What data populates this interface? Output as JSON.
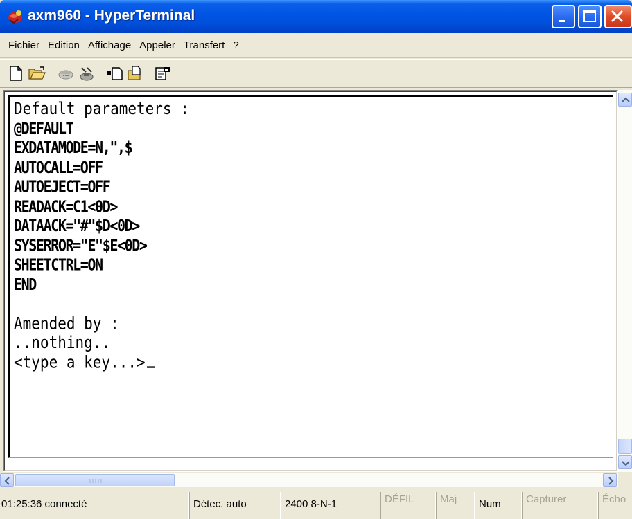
{
  "window": {
    "title": "axm960 - HyperTerminal"
  },
  "menu": [
    "Fichier",
    "Edition",
    "Affichage",
    "Appeler",
    "Transfert",
    "?"
  ],
  "toolbar": {
    "icons": [
      "new-document-icon",
      "open-folder-icon",
      "phone-dial-icon",
      "disconnect-icon",
      "send-icon",
      "receive-icon",
      "properties-icon"
    ]
  },
  "terminal": {
    "lines": [
      {
        "text": "Default parameters :",
        "style": "normal"
      },
      {
        "text": "@DEFAULT",
        "style": "cond"
      },
      {
        "text": "EXDATAMODE=N,\",$",
        "style": "cond"
      },
      {
        "text": "AUTOCALL=OFF",
        "style": "cond"
      },
      {
        "text": "AUTOEJECT=OFF",
        "style": "cond"
      },
      {
        "text": "READACK=C1<0D>",
        "style": "cond"
      },
      {
        "text": "DATAACK=\"#\"$D<0D>",
        "style": "cond"
      },
      {
        "text": "SYSERROR=\"E\"$E<0D>",
        "style": "cond"
      },
      {
        "text": "SHEETCTRL=ON",
        "style": "cond"
      },
      {
        "text": "END",
        "style": "cond"
      },
      {
        "text": "",
        "style": "normal"
      },
      {
        "text": "Amended by :",
        "style": "normal"
      },
      {
        "text": "..nothing..",
        "style": "normal"
      },
      {
        "text": "<type a key...>",
        "style": "normal",
        "cursor": true
      }
    ]
  },
  "status": {
    "connection": "01:25:36 connecté",
    "detect": "Détec. auto",
    "settings": "2400 8-N-1",
    "scroll": "DÉFIL",
    "caps": "Maj",
    "num": "Num",
    "capture": "Capturer",
    "echo": "Écho"
  },
  "colors": {
    "titlebar": "#0054e3",
    "close_button": "#e04a26",
    "window_bg": "#ece9d8"
  }
}
